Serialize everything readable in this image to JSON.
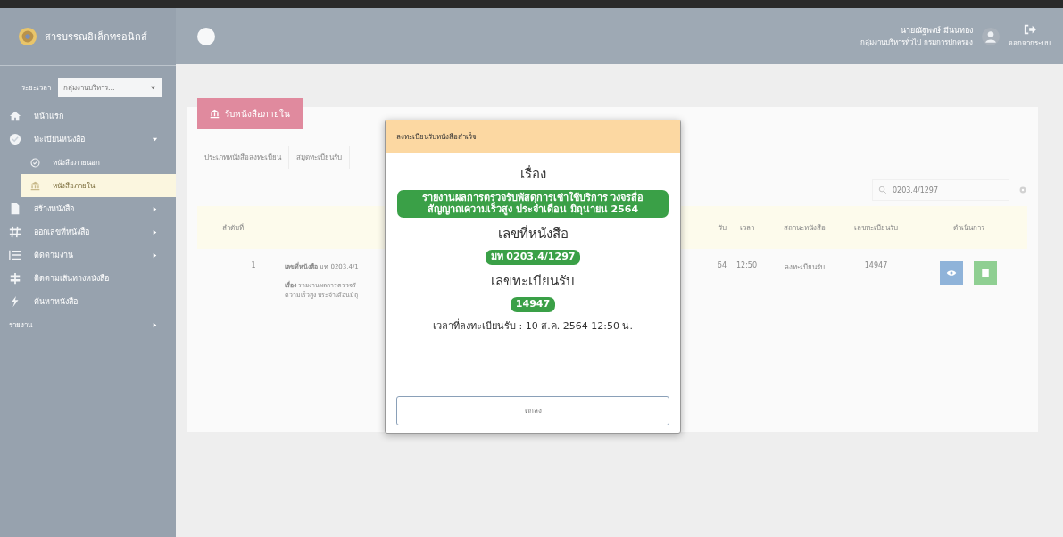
{
  "topbar": {
    "logo_text": "สารบรรณอิเล็กทรอนิกส์",
    "user_name": "นายณัฐพงษ์ มีนนทอง",
    "user_role": "กลุ่มงานบริหารทั่วไป กรมการปกครอง",
    "logout_label": "ออกจากระบบ"
  },
  "sidebar": {
    "filter_label": "ระยะเวลา",
    "filter_value": "กลุ่มงานบริหาร...",
    "items": [
      {
        "kind": "home",
        "label": "หน้าแรก",
        "selected": false
      },
      {
        "kind": "check",
        "label": "ทะเบียนหนังสือ",
        "expanded": true,
        "selected": false,
        "children": [
          {
            "kind": "check",
            "label": "หนังสือภายนอก",
            "selected": false
          },
          {
            "kind": "bank",
            "label": "หนังสือภายใน",
            "selected": true
          }
        ]
      },
      {
        "kind": "doc",
        "label": "สร้างหนังสือ",
        "expanded": false,
        "selected": false
      },
      {
        "kind": "hash",
        "label": "ออกเลขที่หนังสือ",
        "expanded": false,
        "selected": false
      },
      {
        "kind": "list",
        "label": "ติดตามงาน",
        "expanded": false,
        "selected": false
      },
      {
        "kind": "route",
        "label": "ติดตามเส้นทางหนังสือ",
        "selected": false
      },
      {
        "kind": "bolt",
        "label": "ค้นหาหนังสือ",
        "selected": false
      },
      {
        "kind": "section",
        "label": "รายงาน",
        "expanded": false,
        "selected": false
      }
    ]
  },
  "main": {
    "page_button": "รับหนังสือภายใน",
    "tabs": [
      {
        "label": "ประเภทหนังสือลงทะเบียน"
      },
      {
        "label": "สมุดทะเบียนรับ"
      }
    ],
    "search_value": "0203.4/1297",
    "table": {
      "columns": [
        "ลำดับที่",
        "รับ",
        "เวลา",
        "สถานะหนังสือ",
        "เลขทะเบียนรับ",
        "ดำเนินการ"
      ],
      "rows": [
        {
          "no": "1",
          "doc_no_label": "เลขที่หนังสือ",
          "doc_no": "มท 0203.4/1",
          "subject_label": "เรื่อง",
          "subject": "รายงานผลการตรวจรั",
          "subject_line2": "ความเร็วสูง ประจำเดือนมิถุ",
          "date": "64",
          "time": "12:50",
          "status": "ลงทะเบียนรับ",
          "reg_no": "14947"
        }
      ]
    }
  },
  "modal": {
    "title": "ลงทะเบียนรับหนังสือสำเร็จ",
    "subject_heading": "เรื่อง",
    "subject": "รายงานผลการตรวจรับพัสดุการเช่าใช้บริการ วงจรสื่อสัญญาณความเร็วสูง ประจำเดือน มิถุนายน 2564",
    "doc_no_heading": "เลขที่หนังสือ",
    "doc_no": "มท 0203.4/1297",
    "reg_heading": "เลขทะเบียนรับ",
    "reg_no": "14947",
    "time_text": "เวลาที่ลงทะเบียนรับ : 10 ส.ค. 2564 12:50 น.",
    "ok_button": "ตกลง"
  }
}
